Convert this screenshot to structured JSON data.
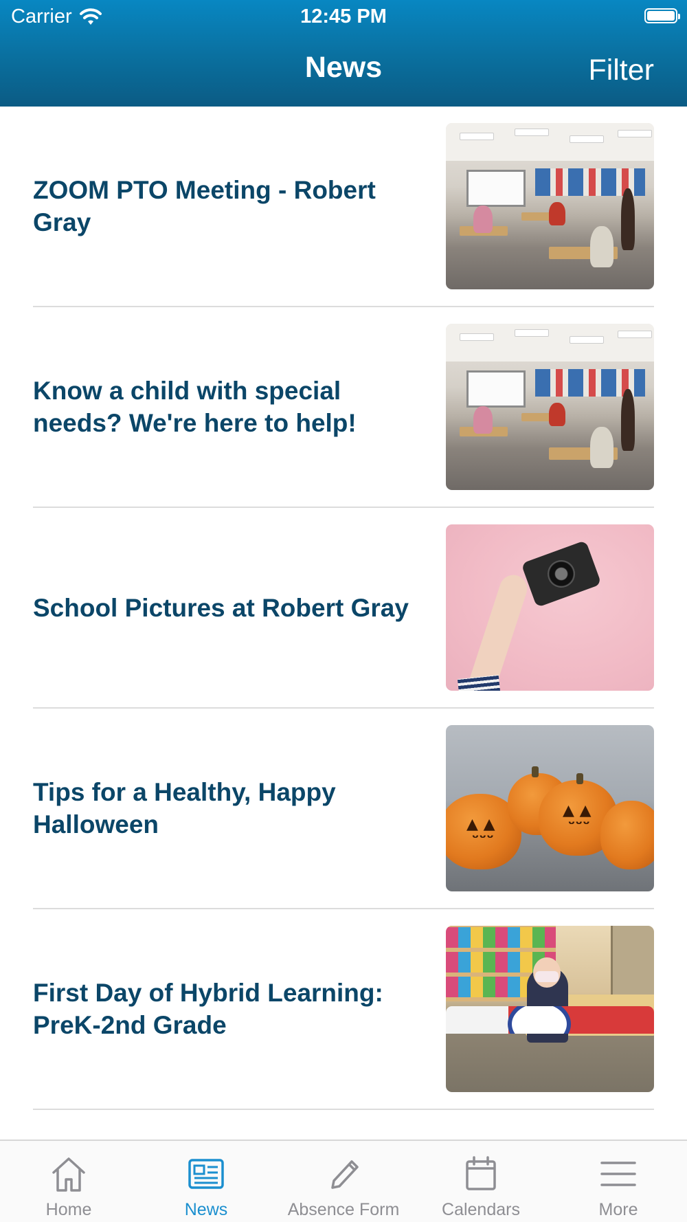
{
  "status_bar": {
    "carrier": "Carrier",
    "time": "12:45 PM",
    "wifi_icon": "wifi-icon",
    "battery_icon": "battery-icon"
  },
  "nav": {
    "title": "News",
    "filter_label": "Filter"
  },
  "articles": [
    {
      "title": "ZOOM PTO Meeting - Robert Gray",
      "image": "classroom-photo"
    },
    {
      "title": "Know a child with special needs? We're here to help!",
      "image": "classroom-photo"
    },
    {
      "title": "School Pictures at Robert Gray",
      "image": "camera-in-hand-photo"
    },
    {
      "title": "Tips for a Healthy, Happy Halloween",
      "image": "jack-o-lanterns-photo"
    },
    {
      "title": "First Day of Hybrid Learning: PreK-2nd Grade",
      "image": "student-at-desk-photo"
    }
  ],
  "tabs": [
    {
      "label": "Home",
      "icon": "home-icon"
    },
    {
      "label": "News",
      "icon": "newspaper-icon",
      "active": true
    },
    {
      "label": "Absence Form",
      "icon": "pencil-icon"
    },
    {
      "label": "Calendars",
      "icon": "calendar-icon"
    },
    {
      "label": "More",
      "icon": "menu-icon"
    }
  ],
  "colors": {
    "header": "#0a7ab3",
    "title_text": "#0b4668",
    "tab_active": "#1b8fcf",
    "tab_inactive": "#8e8e93"
  }
}
